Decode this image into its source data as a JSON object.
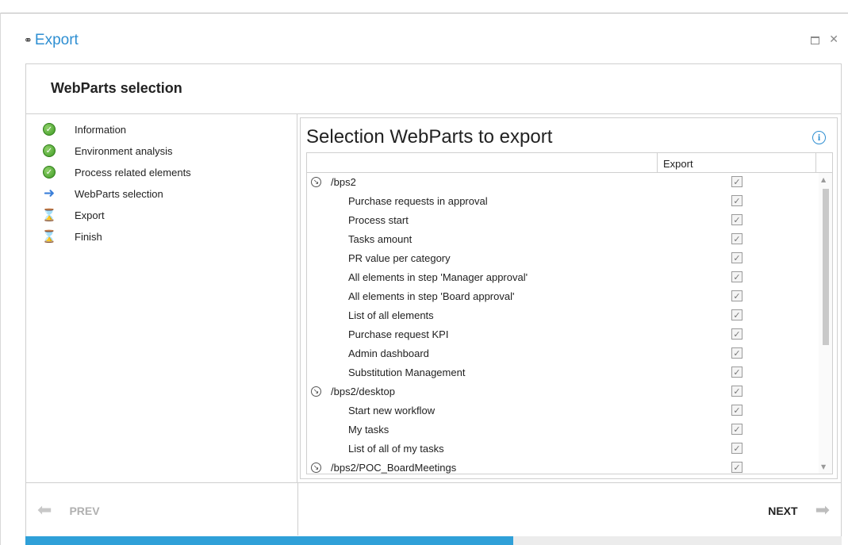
{
  "window": {
    "title": "Export",
    "icon": "link-icon"
  },
  "header": {
    "title": "WebParts selection"
  },
  "steps": [
    {
      "label": "Information",
      "status": "done"
    },
    {
      "label": "Environment analysis",
      "status": "done"
    },
    {
      "label": "Process related elements",
      "status": "done"
    },
    {
      "label": "WebParts selection",
      "status": "current"
    },
    {
      "label": "Export",
      "status": "pending"
    },
    {
      "label": "Finish",
      "status": "pending"
    }
  ],
  "panel": {
    "title": "Selection WebParts to export"
  },
  "grid": {
    "columns": [
      "",
      "Export"
    ],
    "rows": [
      {
        "type": "group",
        "name": "/bps2",
        "export": true
      },
      {
        "type": "child",
        "name": "Purchase requests in approval",
        "export": true
      },
      {
        "type": "child",
        "name": "Process start",
        "export": true
      },
      {
        "type": "child",
        "name": "Tasks amount",
        "export": true
      },
      {
        "type": "child",
        "name": "PR value per category",
        "export": true
      },
      {
        "type": "child",
        "name": "All elements in step 'Manager approval'",
        "export": true
      },
      {
        "type": "child",
        "name": "All elements in step 'Board approval'",
        "export": true
      },
      {
        "type": "child",
        "name": "List of all elements",
        "export": true
      },
      {
        "type": "child",
        "name": "Purchase request KPI",
        "export": true
      },
      {
        "type": "child",
        "name": "Admin dashboard",
        "export": true
      },
      {
        "type": "child",
        "name": "Substitution Management",
        "export": true
      },
      {
        "type": "group",
        "name": "/bps2/desktop",
        "export": true
      },
      {
        "type": "child",
        "name": "Start new workflow",
        "export": true
      },
      {
        "type": "child",
        "name": "My tasks",
        "export": true
      },
      {
        "type": "child",
        "name": "List of all of my tasks",
        "export": true
      },
      {
        "type": "group",
        "name": "/bps2/POC_BoardMeetings",
        "export": true
      }
    ]
  },
  "footer": {
    "prev_label": "PREV",
    "next_label": "NEXT"
  },
  "progress": {
    "fraction": 0.598
  },
  "colors": {
    "accent": "#2f8fd2",
    "progress": "#2fa0d8"
  }
}
